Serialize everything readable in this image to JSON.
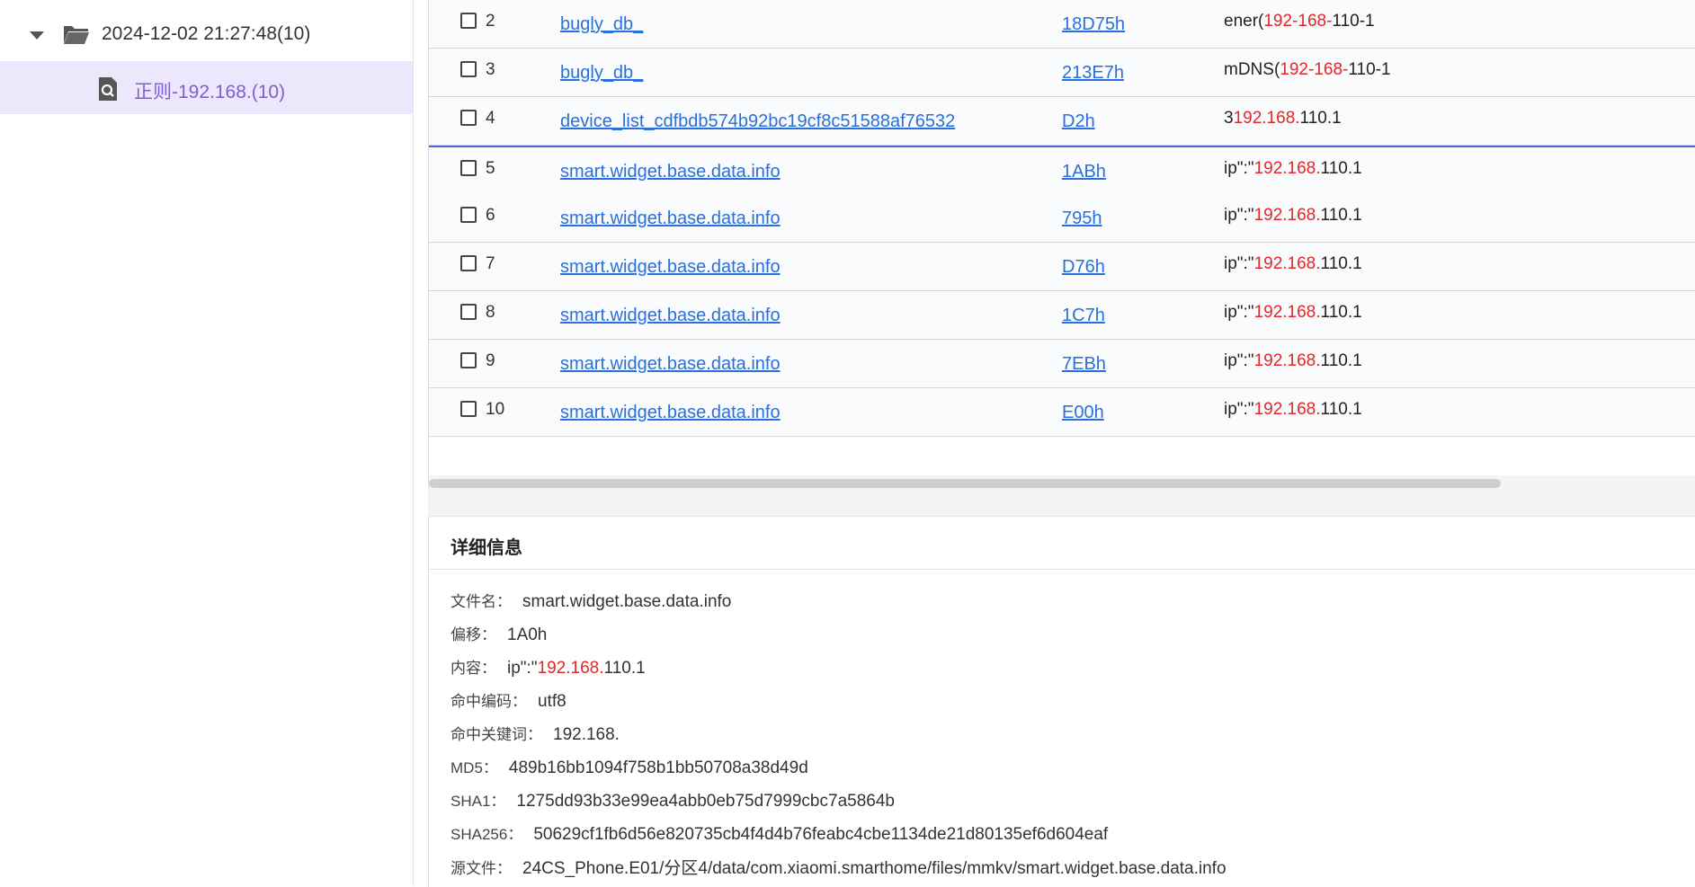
{
  "sidebar": {
    "root_label": "2024-12-02 21:27:48(10)",
    "child_label": "正则-192.168.(10)"
  },
  "table": {
    "rows": [
      {
        "num": "2",
        "name": "bugly_db_",
        "offset": "18D75h",
        "pre": "ener(",
        "hit": "192-168-",
        "post": "110-1",
        "highlight": false
      },
      {
        "num": "3",
        "name": "bugly_db_",
        "offset": "213E7h",
        "pre": "mDNS(",
        "hit": "192-168-",
        "post": "110-1",
        "highlight": false
      },
      {
        "num": "4",
        "name": "device_list_cdfbdb574b92bc19cf8c51588af76532",
        "offset": "D2h",
        "pre": "3",
        "hit": "192.168.",
        "post": "110.1",
        "highlight": false
      },
      {
        "num": "5",
        "name": "smart.widget.base.data.info",
        "offset": "1ABh",
        "pre": "ip\":\"",
        "hit": "192.168.",
        "post": "110.1",
        "highlight": true
      },
      {
        "num": "6",
        "name": "smart.widget.base.data.info",
        "offset": "795h",
        "pre": "ip\":\"",
        "hit": "192.168.",
        "post": "110.1",
        "highlight": false
      },
      {
        "num": "7",
        "name": "smart.widget.base.data.info",
        "offset": "D76h",
        "pre": "ip\":\"",
        "hit": "192.168.",
        "post": "110.1",
        "highlight": false
      },
      {
        "num": "8",
        "name": "smart.widget.base.data.info",
        "offset": "1C7h",
        "pre": "ip\":\"",
        "hit": "192.168.",
        "post": "110.1",
        "highlight": false
      },
      {
        "num": "9",
        "name": "smart.widget.base.data.info",
        "offset": "7EBh",
        "pre": "ip\":\"",
        "hit": "192.168.",
        "post": "110.1",
        "highlight": false
      },
      {
        "num": "10",
        "name": "smart.widget.base.data.info",
        "offset": "E00h",
        "pre": "ip\":\"",
        "hit": "192.168.",
        "post": "110.1",
        "highlight": false
      }
    ]
  },
  "detail": {
    "title": "详细信息",
    "filename_label": "文件名：",
    "filename": "smart.widget.base.data.info",
    "offset_label": "偏移：",
    "offset": "1A0h",
    "content_label": "内容：",
    "content_pre": "ip\":\"",
    "content_hit": "192.168.",
    "content_post": "110.1",
    "encoding_label": "命中编码：",
    "encoding": "utf8",
    "keyword_label": "命中关键词：",
    "keyword": "192.168.",
    "md5_label": "MD5：",
    "md5": "489b16bb1094f758b1bb50708a38d49d",
    "sha1_label": "SHA1：",
    "sha1": "1275dd93b33e99ea4abb0eb75d7999cbc7a5864b",
    "sha256_label": "SHA256：",
    "sha256": "50629cf1fb6d56e820735cb4f4d4b76feabc4cbe1134de21d80135ef6d604eaf",
    "source_label": "源文件：",
    "source": "24CS_Phone.E01/分区4/data/com.xiaomi.smarthome/files/mmkv/smart.widget.base.data.info"
  }
}
